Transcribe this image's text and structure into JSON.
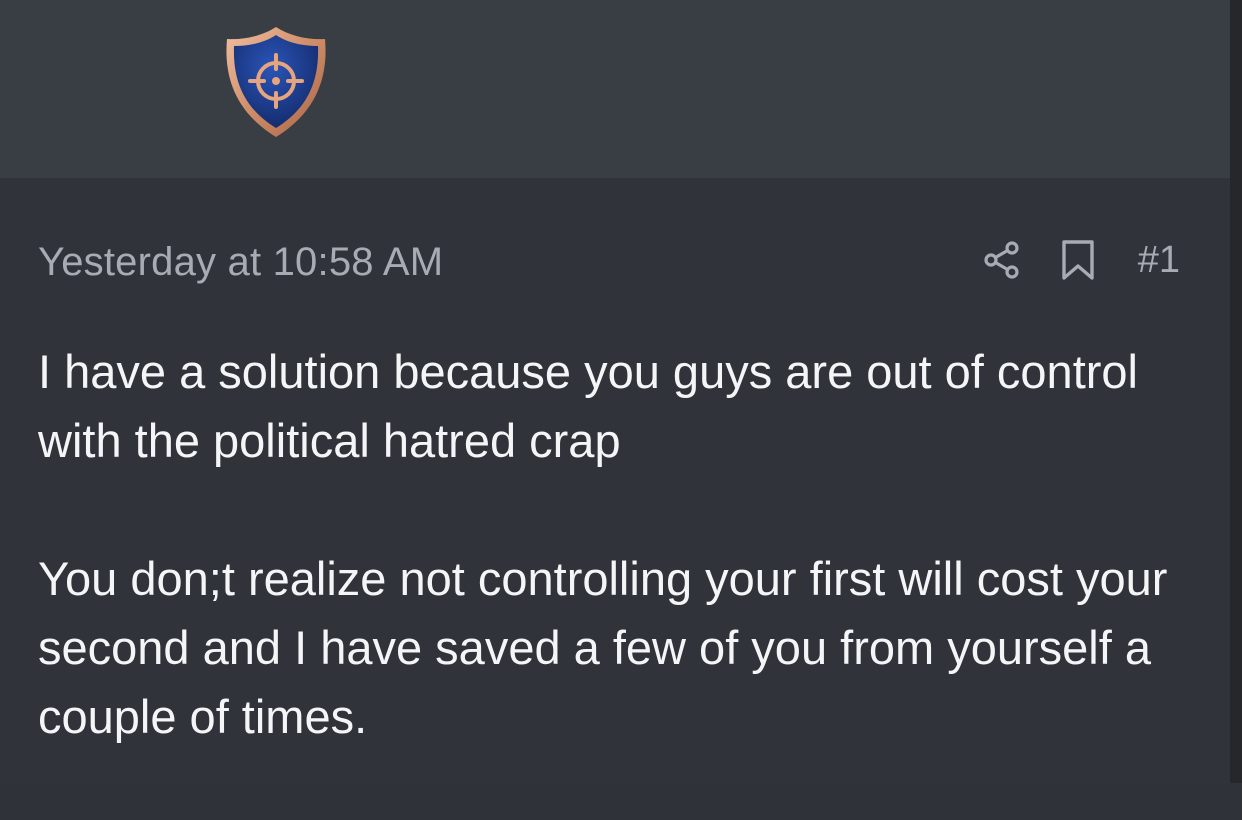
{
  "post": {
    "date": "Yesterday at 10:58 AM",
    "number": "#1",
    "paragraphs": [
      "I have a solution because you guys are out of control with the political hatred crap",
      "You don;t realize not controlling your first will cost your second and I have saved a few of you from yourself a couple of times."
    ]
  },
  "icons": {
    "badge": "crosshair-shield-icon",
    "share": "share-icon",
    "bookmark": "bookmark-icon"
  },
  "colors": {
    "header_bg": "#393d44",
    "post_bg": "#303339",
    "badge_blue": "#1d3a8c",
    "badge_copper": "#d89a78",
    "meta_text": "#a7abb3",
    "body_text": "#f4f5f7"
  }
}
